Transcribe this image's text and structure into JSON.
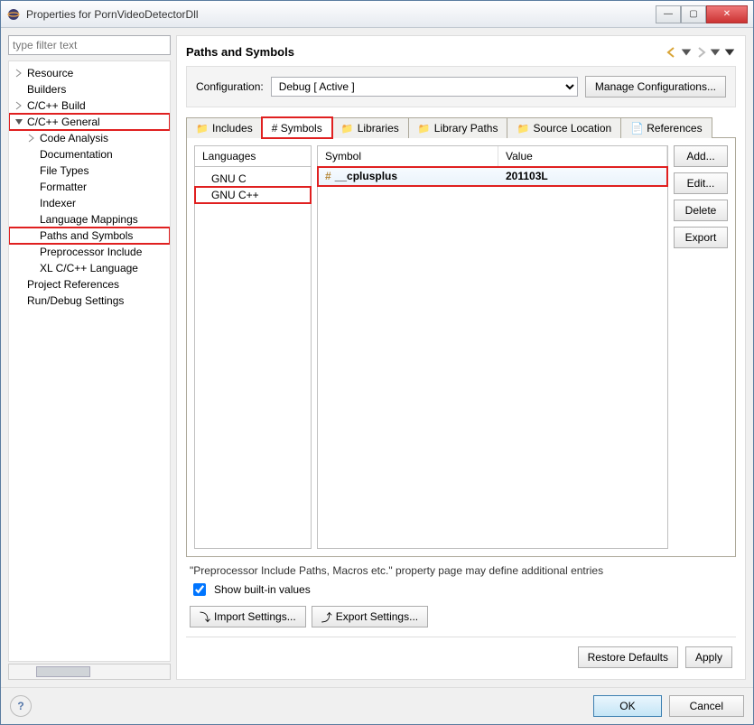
{
  "window": {
    "title": "Properties for PornVideoDetectorDll"
  },
  "filter": {
    "placeholder": "type filter text"
  },
  "tree": {
    "resource": "Resource",
    "builders": "Builders",
    "ccbuild": "C/C++ Build",
    "ccgeneral": "C/C++ General",
    "codeanalysis": "Code Analysis",
    "documentation": "Documentation",
    "filetypes": "File Types",
    "formatter": "Formatter",
    "indexer": "Indexer",
    "langmappings": "Language Mappings",
    "pathssymbols": "Paths and Symbols",
    "preprocessor": "Preprocessor Include",
    "xlcclanguage": "XL C/C++ Language",
    "projectrefs": "Project References",
    "rundebug": "Run/Debug Settings"
  },
  "page": {
    "heading": "Paths and Symbols",
    "config_label": "Configuration:",
    "config_value": "Debug  [ Active ]",
    "manage_btn": "Manage Configurations..."
  },
  "tabs": {
    "includes": "Includes",
    "symbols": "# Symbols",
    "libraries": "Libraries",
    "librarypaths": "Library Paths",
    "sourceloc": "Source Location",
    "references": "References"
  },
  "languages": {
    "header": "Languages",
    "items": [
      "GNU C",
      "GNU C++"
    ]
  },
  "symbols": {
    "col1": "Symbol",
    "col2": "Value",
    "rows": [
      {
        "name": "__cplusplus",
        "value": "201103L"
      }
    ]
  },
  "sidebuttons": {
    "add": "Add...",
    "edit": "Edit...",
    "delete": "Delete",
    "export": "Export"
  },
  "note": "\"Preprocessor Include Paths, Macros etc.\" property page may define additional entries",
  "builtin_label": "Show built-in values",
  "import_btn": "Import Settings...",
  "export_btn": "Export Settings...",
  "restore_btn": "Restore Defaults",
  "apply_btn": "Apply",
  "ok_btn": "OK",
  "cancel_btn": "Cancel"
}
